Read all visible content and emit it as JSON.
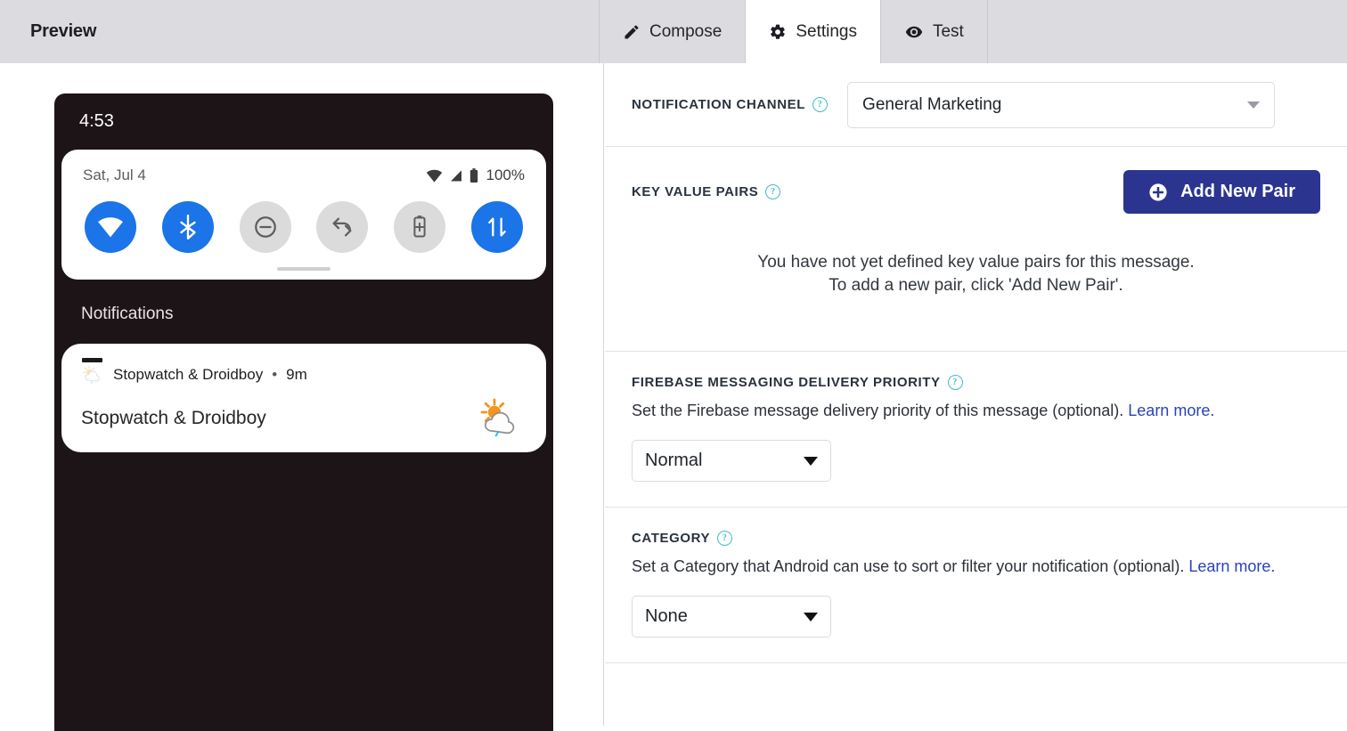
{
  "topbar": {
    "title": "Preview",
    "tabs": [
      {
        "label": "Compose",
        "icon": "pencil-icon",
        "active": false
      },
      {
        "label": "Settings",
        "icon": "gear-icon",
        "active": true
      },
      {
        "label": "Test",
        "icon": "eye-icon",
        "active": false
      }
    ]
  },
  "preview": {
    "status_time": "4:53",
    "quick_settings": {
      "date": "Sat, Jul 4",
      "battery_percent": "100%",
      "tiles": [
        {
          "name": "wifi-tile",
          "state": "on"
        },
        {
          "name": "bluetooth-tile",
          "state": "on"
        },
        {
          "name": "do-not-disturb-tile",
          "state": "off"
        },
        {
          "name": "auto-rotate-tile",
          "state": "off"
        },
        {
          "name": "battery-saver-tile",
          "state": "off"
        },
        {
          "name": "mobile-data-tile",
          "state": "on"
        }
      ]
    },
    "notifications_header": "Notifications",
    "notification": {
      "app_name": "Stopwatch & Droidboy",
      "separator": "•",
      "time": "9m",
      "title": "Stopwatch & Droidboy",
      "icon": "weather-sun-cloud-rain-icon"
    }
  },
  "settings": {
    "notification_channel": {
      "label": "Notification Channel",
      "help": "?",
      "selected": "General Marketing"
    },
    "key_value_pairs": {
      "label": "Key Value Pairs",
      "help": "?",
      "add_button": "Add New Pair",
      "empty_line_1": "You have not yet defined key value pairs for this message.",
      "empty_line_2": "To add a new pair, click 'Add New Pair'."
    },
    "delivery_priority": {
      "label": "Firebase Messaging Delivery Priority",
      "help": "?",
      "description": "Set the Firebase message delivery priority of this message (optional).",
      "learn_more": "Learn more.",
      "selected": "Normal"
    },
    "category": {
      "label": "Category",
      "help": "?",
      "description": "Set a Category that Android can use to sort or filter your notification (optional).",
      "learn_more": "Learn more.",
      "selected": "None"
    }
  },
  "colors": {
    "topbar_bg": "#dcdce0",
    "accent_button": "#2b3590",
    "help_icon": "#3fbfc2",
    "link": "#2a43b8",
    "tile_on": "#1b74e8",
    "tile_off": "#dbdbdb",
    "phone_bg": "#1d1418"
  }
}
